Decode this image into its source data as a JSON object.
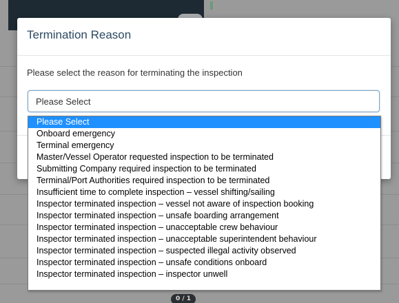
{
  "modal": {
    "title": "Termination Reason",
    "prompt": "Please select the reason for terminating the inspection",
    "select_value": "Please Select"
  },
  "dropdown": {
    "selected_index": 0,
    "options": [
      "Please Select",
      "Onboard emergency",
      "Terminal emergency",
      "Master/Vessel Operator requested inspection to be terminated",
      "Submitting Company required inspection to be terminated",
      "Terminal/Port Authorities required inspection to be terminated",
      "Insufficient time to complete inspection – vessel shifting/sailing",
      "Inspector terminated inspection – vessel not aware of inspection booking",
      "Inspector terminated inspection – unsafe boarding arrangement",
      "Inspector terminated inspection – unacceptable crew behaviour",
      "Inspector terminated inspection – unacceptable superintendent behaviour",
      "Inspector terminated inspection – suspected illegal activity observed",
      "Inspector terminated inspection – unsafe conditions onboard",
      "Inspector terminated inspection – inspector unwell"
    ]
  },
  "background": {
    "badge": "0 / 1"
  },
  "colors": {
    "selected_option": "#1e90ff",
    "title_text": "#2c4a63",
    "overlay": "#9a9a9a"
  }
}
